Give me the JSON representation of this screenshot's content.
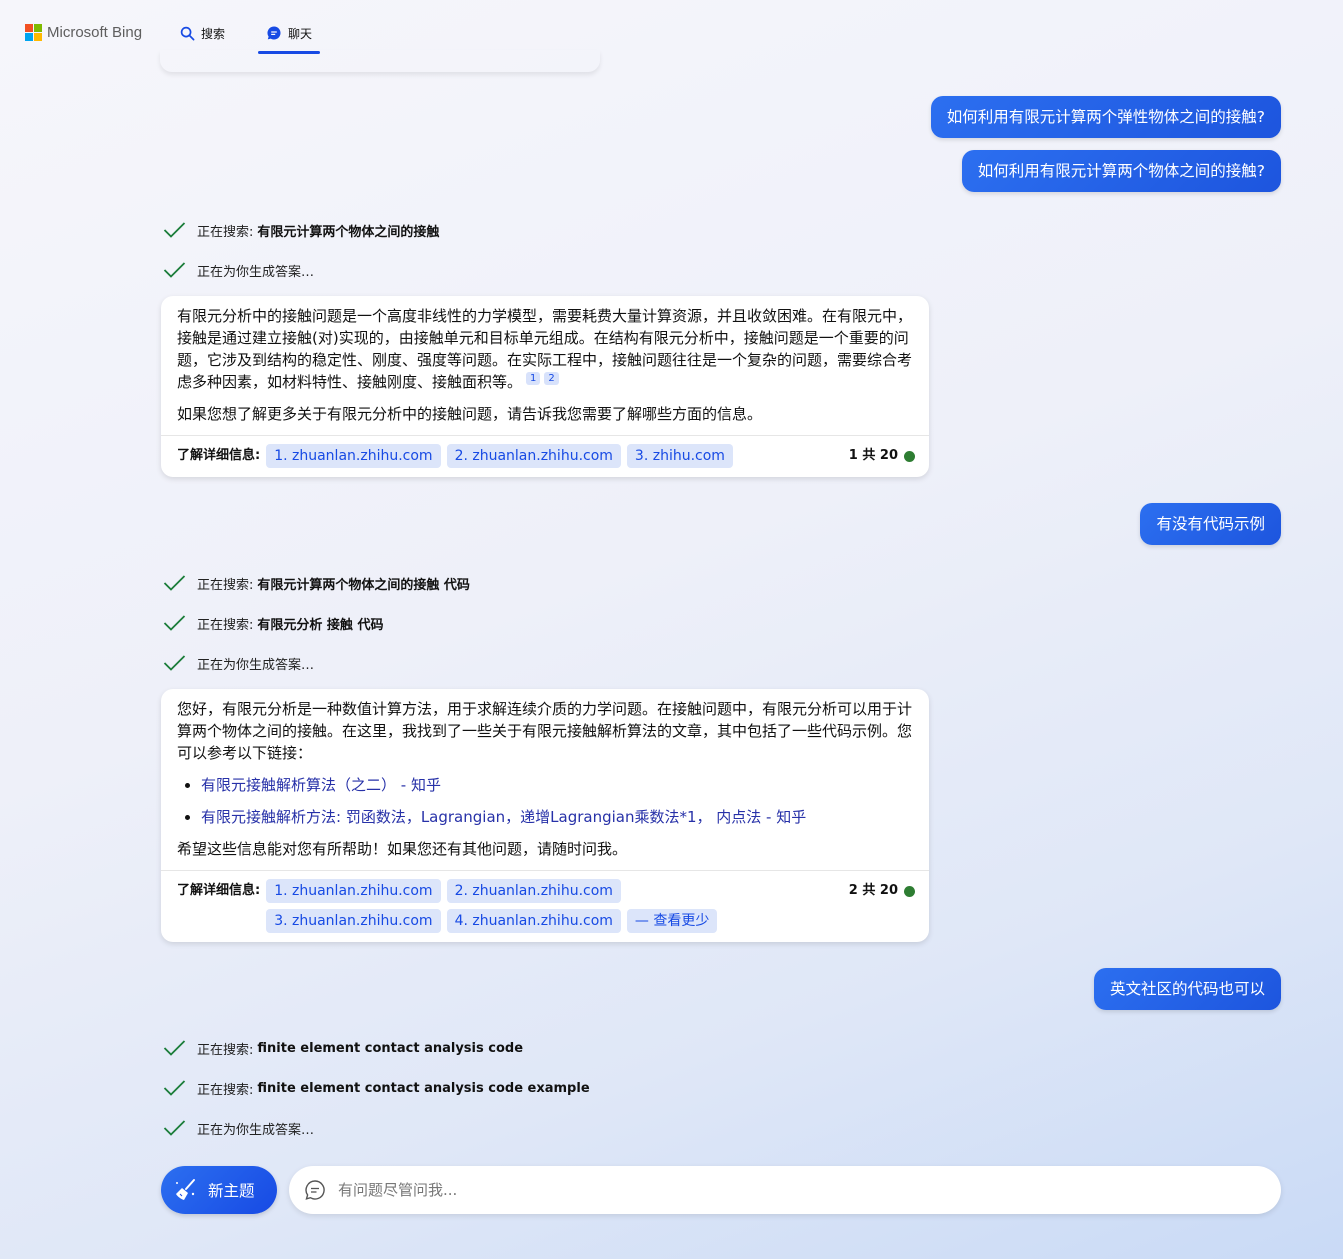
{
  "header": {
    "brand": "Microsoft Bing",
    "tabs": [
      {
        "label": "搜索",
        "icon": "search-icon"
      },
      {
        "label": "聊天",
        "icon": "chat-icon",
        "active": true
      }
    ]
  },
  "colors": {
    "accent": "#174ae4",
    "user_bubble": "#2563eb",
    "check": "#1b7d3a",
    "status_dot": "#2e7d32"
  },
  "conversation": {
    "user_messages": [
      "如何利用有限元计算两个弹性物体之间的接触?",
      "如何利用有限元计算两个物体之间的接触?",
      "有没有代码示例",
      "英文社区的代码也可以"
    ],
    "status_group_1": [
      {
        "prefix": "正在搜索:",
        "query": "有限元计算两个物体之间的接触"
      },
      {
        "prefix": "正在为你生成答案…",
        "query": ""
      }
    ],
    "answer_1": {
      "paragraph_1": "有限元分析中的接触问题是一个高度非线性的力学模型，需要耗费大量计算资源，并且收敛困难。在有限元中，接触是通过建立接触(对)实现的，由接触单元和目标单元组成。在结构有限元分析中，接触问题是一个重要的问题，它涉及到结构的稳定性、刚度、强度等问题。在实际工程中，接触问题往往是一个复杂的问题，需要综合考虑多种因素，如材料特性、接触刚度、接触面积等。",
      "citations": [
        "1",
        "2"
      ],
      "paragraph_2": "如果您想了解更多关于有限元分析中的接触问题，请告诉我您需要了解哪些方面的信息。",
      "learn_more_label": "了解详细信息:",
      "sources": [
        "1. zhuanlan.zhihu.com",
        "2. zhuanlan.zhihu.com",
        "3. zhihu.com"
      ],
      "counter": "1 共 20"
    },
    "status_group_2": [
      {
        "prefix": "正在搜索:",
        "query": "有限元计算两个物体之间的接触 代码"
      },
      {
        "prefix": "正在搜索:",
        "query": "有限元分析 接触 代码"
      },
      {
        "prefix": "正在为你生成答案…",
        "query": ""
      }
    ],
    "answer_2": {
      "paragraph_1": "您好，有限元分析是一种数值计算方法，用于求解连续介质的力学问题。在接触问题中，有限元分析可以用于计算两个物体之间的接触。在这里，我找到了一些关于有限元接触解析算法的文章，其中包括了一些代码示例。您可以参考以下链接：",
      "links": [
        "有限元接触解析算法（之二） - 知乎",
        "有限元接触解析方法: 罚函数法，Lagrangian，递增Lagrangian乘数法*1， 内点法 - 知乎"
      ],
      "paragraph_2": "希望这些信息能对您有所帮助！如果您还有其他问题，请随时问我。",
      "learn_more_label": "了解详细信息:",
      "sources": [
        "1. zhuanlan.zhihu.com",
        "2. zhuanlan.zhihu.com",
        "3. zhuanlan.zhihu.com",
        "4. zhuanlan.zhihu.com"
      ],
      "see_less": "— 查看更少",
      "counter": "2 共 20"
    },
    "status_group_3": [
      {
        "prefix": "正在搜索:",
        "query": "finite element contact analysis code"
      },
      {
        "prefix": "正在搜索:",
        "query": "finite element contact analysis code example"
      },
      {
        "prefix": "正在为你生成答案…",
        "query": ""
      }
    ]
  },
  "composer": {
    "new_topic_label": "新主题",
    "placeholder": "有问题尽管问我..."
  }
}
